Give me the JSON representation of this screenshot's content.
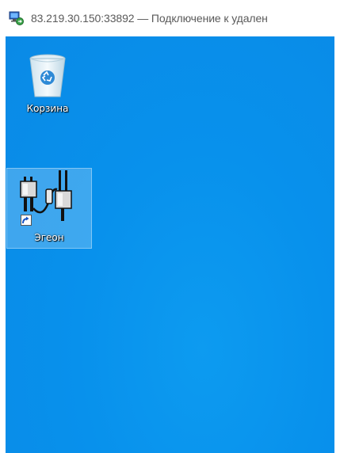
{
  "window": {
    "title": "83.219.30.150:33892 — Подключение к удален",
    "icon": "remote-desktop-icon"
  },
  "desktop": {
    "background_color": "#0a8ae6",
    "icons": [
      {
        "label": "Корзина",
        "icon": "recycle-bin-icon",
        "selected": false
      },
      {
        "label": "Эгеон",
        "icon": "egeon-connector-icon",
        "shortcut": true,
        "selected": true
      }
    ]
  }
}
